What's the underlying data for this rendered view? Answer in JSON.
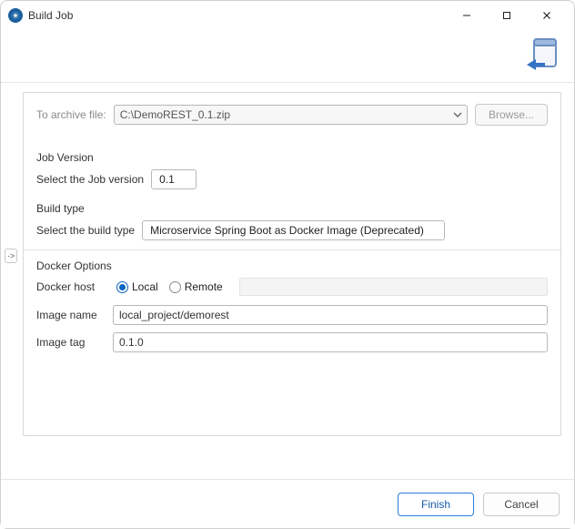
{
  "window": {
    "title": "Build Job"
  },
  "archive": {
    "label": "To archive file:",
    "value": "C:\\DemoREST_0.1.zip",
    "browse": "Browse..."
  },
  "job_version": {
    "group": "Job Version",
    "label": "Select the Job version",
    "value": "0.1"
  },
  "build_type": {
    "group": "Build type",
    "label": "Select the build type",
    "value": "Microservice Spring Boot as Docker Image (Deprecated)"
  },
  "docker": {
    "group": "Docker Options",
    "host_label": "Docker host",
    "local": "Local",
    "remote": "Remote",
    "host_selected": "local",
    "image_name_label": "Image name",
    "image_name": "local_project/demorest",
    "image_tag_label": "Image tag",
    "image_tag": "0.1.0"
  },
  "footer": {
    "finish": "Finish",
    "cancel": "Cancel"
  },
  "side_handle": "·>"
}
